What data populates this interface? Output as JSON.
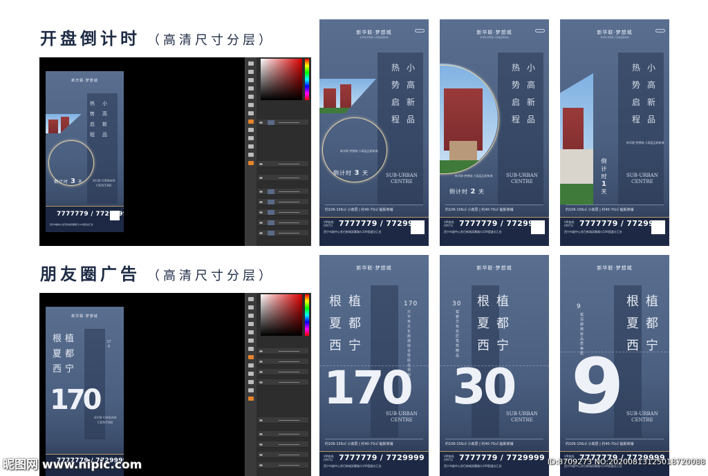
{
  "sections": [
    {
      "title": "开盘倒计时",
      "subtitle": "（高清尺寸分层）"
    },
    {
      "title": "朋友圈广告",
      "subtitle": "（高清尺寸分层）"
    }
  ],
  "poster_common": {
    "logo": "新华联·梦想城",
    "slogan_chars": "热小势高启新程品",
    "suburban": "SUB-URBAN",
    "centre": "CENTRE",
    "specs": "约106-156㎡ 小高层 | 约40-70㎡ 临街商铺",
    "vip": "VIP热线",
    "vip2": "(0971)",
    "phone": "7777779 / 7729999",
    "address": "西宁市副中心多巴新城双寨路与109国道交汇处",
    "tagline": "新华联·梦想城 小高层品质新城",
    "countdown_prefix": "倒计时",
    "countdown_unit": "天",
    "ad_headline": "根植夏都西宁"
  },
  "countdown_posters": [
    {
      "days": "3"
    },
    {
      "days": "2"
    },
    {
      "days": "1"
    }
  ],
  "ad_posters": [
    {
      "number": "170",
      "side_number": "170",
      "side_text": "万平米文化旅游综合体 民企领衔 匠心造城"
    },
    {
      "number": "30",
      "side_number": "30",
      "side_text": "载春华秋实 匠笔筑精品"
    },
    {
      "number": "9",
      "side_number": "9",
      "side_text": "载深耕 铸就品质美居"
    }
  ],
  "watermark": {
    "left": "昵图网 www.nipic.com",
    "right": "ID:8709273 NO:20200813125018720088"
  }
}
